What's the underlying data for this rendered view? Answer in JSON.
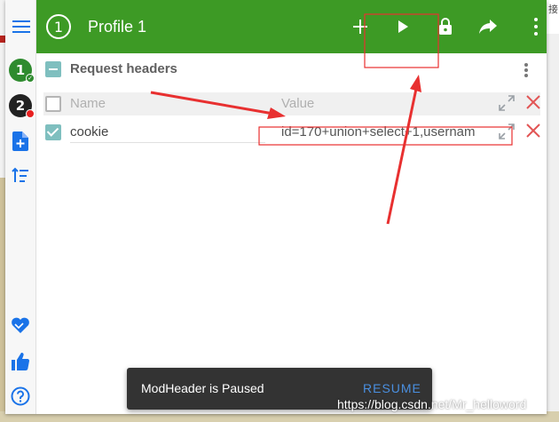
{
  "header": {
    "profile_number": "1",
    "profile_title": "Profile 1"
  },
  "sidebar": {
    "profiles": [
      {
        "number": "1",
        "status": "active"
      },
      {
        "number": "2",
        "status": "error"
      }
    ]
  },
  "section": {
    "title": "Request headers"
  },
  "table": {
    "name_placeholder": "Name",
    "value_placeholder": "Value",
    "rows": [
      {
        "name": "cookie",
        "value": "id=170+union+select+1,usernam",
        "enabled": true
      }
    ]
  },
  "snackbar": {
    "message": "ModHeader is Paused",
    "action": "RESUME"
  },
  "watermark": "https://blog.csdn.net/Mr_helloword",
  "corner_glyph": "接",
  "colors": {
    "header_green": "#3d9a25",
    "checkbox_teal": "#7fbfbf",
    "delete_red": "#e25555",
    "annotation_red": "#e83030",
    "snackbar_bg": "#333333",
    "snackbar_action": "#4a8fe0"
  },
  "icons": {
    "menu": "hamburger-icon",
    "add": "plus-icon",
    "play": "play-icon",
    "lock": "lock-icon",
    "share": "share-arrow-icon",
    "more": "more-vert-icon",
    "add_file": "add-file-icon",
    "sort": "sort-icon",
    "heart": "heart-hands-icon",
    "thumbs_up": "thumbs-up-icon",
    "help": "help-icon",
    "expand": "expand-icon",
    "delete": "close-icon"
  }
}
